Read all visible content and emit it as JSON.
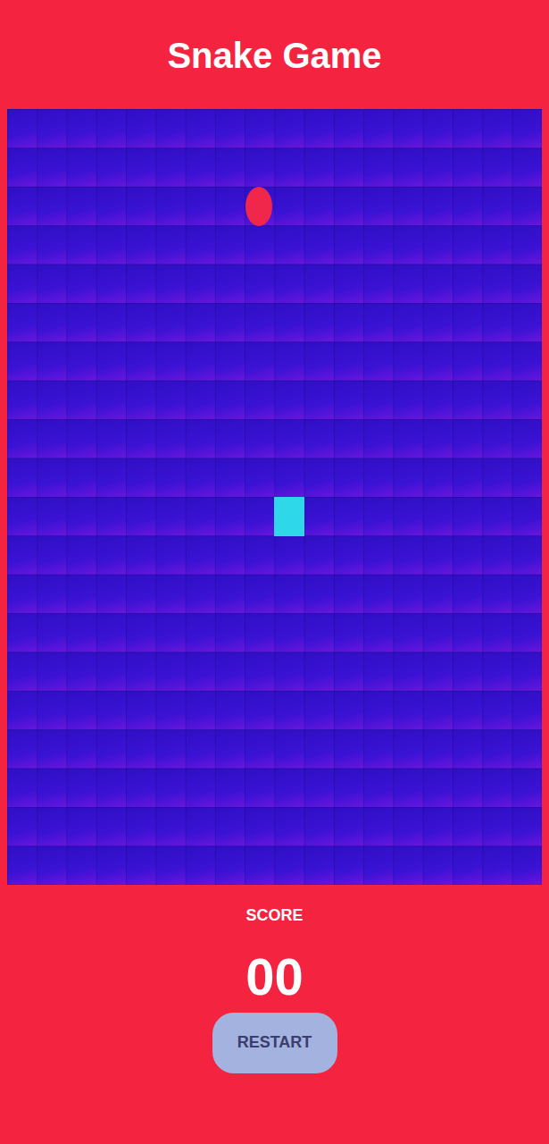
{
  "header": {
    "title": "Snake Game"
  },
  "board": {
    "cols": 18,
    "rows": 20,
    "food": {
      "col": 9,
      "row": 3
    },
    "snake": [
      {
        "col": 10,
        "row": 11
      }
    ]
  },
  "score": {
    "label": "SCORE",
    "value": "00"
  },
  "buttons": [
    {
      "label": "RESTART"
    }
  ]
}
